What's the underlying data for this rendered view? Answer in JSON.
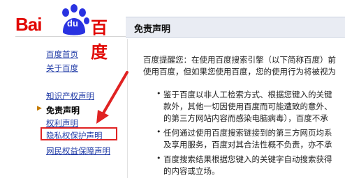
{
  "logo": {
    "left_text": "Bai",
    "du_text": "du",
    "right_text": "百度"
  },
  "header": {
    "title": "免责声明"
  },
  "sidebar": {
    "group1": [
      "百度首页",
      "关于百度"
    ],
    "items": [
      {
        "label": "知识产权声明",
        "current": false
      },
      {
        "label": "免责声明",
        "current": true
      },
      {
        "label": "权利声明",
        "current": false
      },
      {
        "label": "隐私权保护声明",
        "current": false,
        "highlighted": true
      },
      {
        "label": "网民权益保障声明",
        "current": false
      }
    ]
  },
  "main": {
    "intro": [
      "百度提醒您：在使用百度搜索引擎（以下简称百度）前",
      "使用百度，但如果您使用百度，您的使用行为将被视为"
    ],
    "bullets": [
      [
        "鉴于百度以非人工检索方式、根据您键入的关键",
        "款外，其他一切因使用百度而可能遭致的意外、",
        "的第三方网站内容而感染电脑病毒），百度不承"
      ],
      [
        "任何通过使用百度搜索链接到的第三方网页均系",
        "及享用服务，百度对其合法性概不负责，亦不承"
      ],
      [
        "百度搜索结果根据您键入的关键字自动搜索获得",
        "的内容或立场。"
      ]
    ]
  },
  "colors": {
    "brand_red": "#e10602",
    "brand_blue": "#2932e1",
    "link": "#1f3aa6",
    "annotation_red": "#e02222"
  }
}
